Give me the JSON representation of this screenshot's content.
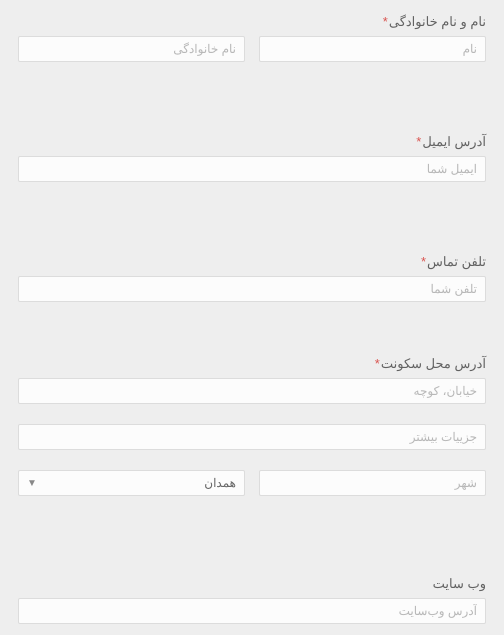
{
  "name": {
    "label": "نام و نام خانوادگی",
    "required": "*",
    "first_placeholder": "نام",
    "last_placeholder": "نام خانوادگی"
  },
  "email": {
    "label": "آدرس ایمیل",
    "required": "*",
    "placeholder": "ایمیل شما"
  },
  "phone": {
    "label": "تلفن تماس",
    "required": "*",
    "placeholder": "تلفن شما"
  },
  "address": {
    "label": "آدرس محل سکونت",
    "required": "*",
    "street_placeholder": "خیابان، کوچه",
    "more_placeholder": "جزییات بیشتر",
    "city_placeholder": "شهر",
    "province_selected": "همدان",
    "arrow": "▼"
  },
  "website": {
    "label": "وب سایت",
    "placeholder": "آدرس وب‌سایت"
  }
}
